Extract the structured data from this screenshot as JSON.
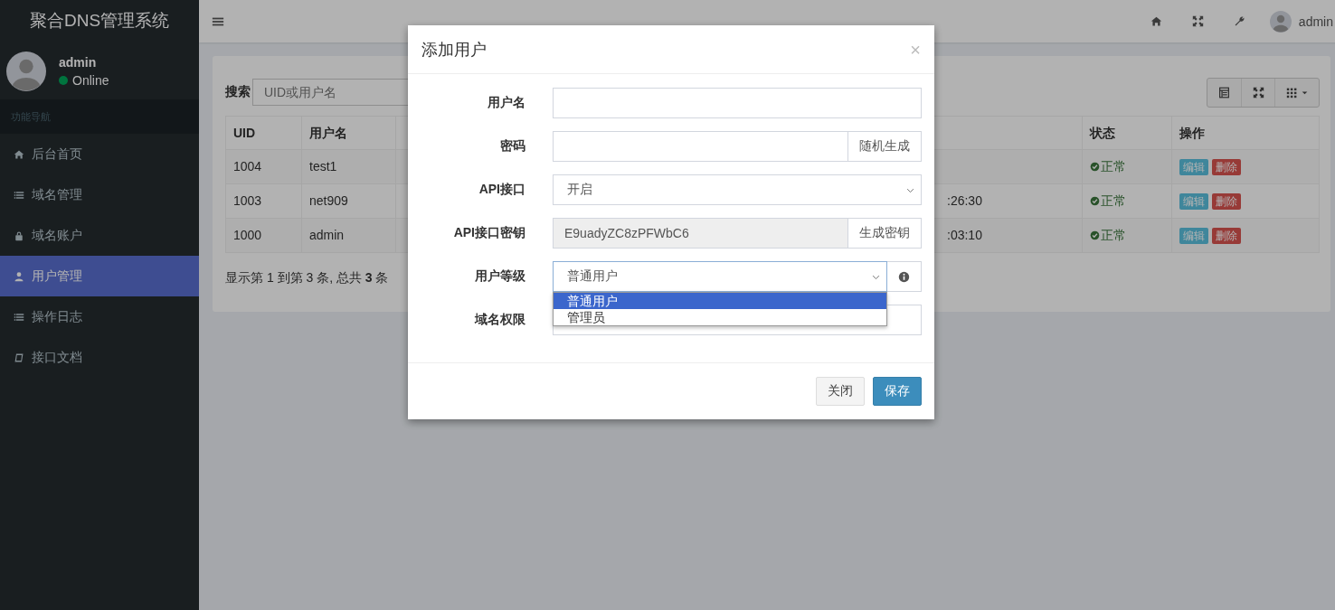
{
  "sidebar": {
    "brand": "聚合DNS管理系统",
    "user": {
      "name": "admin",
      "status": "Online"
    },
    "nav_header": "功能导航",
    "items": [
      {
        "label": "后台首页",
        "selected": false
      },
      {
        "label": "域名管理",
        "selected": false
      },
      {
        "label": "域名账户",
        "selected": false
      },
      {
        "label": "用户管理",
        "selected": true
      },
      {
        "label": "操作日志",
        "selected": false
      },
      {
        "label": "接口文档",
        "selected": false
      }
    ]
  },
  "topbar": {
    "user": "admin"
  },
  "panel": {
    "search_label": "搜索",
    "search_placeholder": "UID或用户名",
    "table": {
      "columns": [
        "UID",
        "用户名",
        "状态",
        "操作"
      ],
      "rows": [
        {
          "uid": "1004",
          "username": "test1",
          "status": "正常",
          "actions": [
            "编辑",
            "删除"
          ]
        },
        {
          "uid": "1003",
          "username": "net909",
          "column_4": ":26:30",
          "status": "正常",
          "actions": [
            "编辑",
            "删除"
          ]
        },
        {
          "uid": "1000",
          "username": "admin",
          "column_4": ":03:10",
          "status": "正常",
          "actions": [
            "编辑",
            "删除"
          ]
        }
      ]
    },
    "summary": "显示第 1 到第 3 条, 总共 **3** 条"
  },
  "modal": {
    "title": "添加用户",
    "close": "×",
    "fields": [
      {
        "kind": "input",
        "label": "用户名"
      },
      {
        "kind": "addon",
        "label": "密码",
        "addon": "随机生成",
        "readonly": false
      },
      {
        "kind": "select",
        "label": "API接口",
        "value": "开启"
      },
      {
        "kind": "addon",
        "label": "API接口密钥",
        "value": "E9uadyZC8zPFWbC6",
        "addon": "生成密钥",
        "readonly": true
      },
      {
        "kind": "dropdown",
        "label": "用户等级",
        "value": "普通用户",
        "expanded": true,
        "options": [
          {
            "label": "普通用户",
            "selected": true
          },
          {
            "label": "管理员",
            "selected": false
          }
        ]
      },
      {
        "kind": "input",
        "label": "域名权限"
      }
    ],
    "buttons": [
      {
        "label": "关闭",
        "kind": "default"
      },
      {
        "label": "保存",
        "kind": "primary"
      }
    ]
  }
}
